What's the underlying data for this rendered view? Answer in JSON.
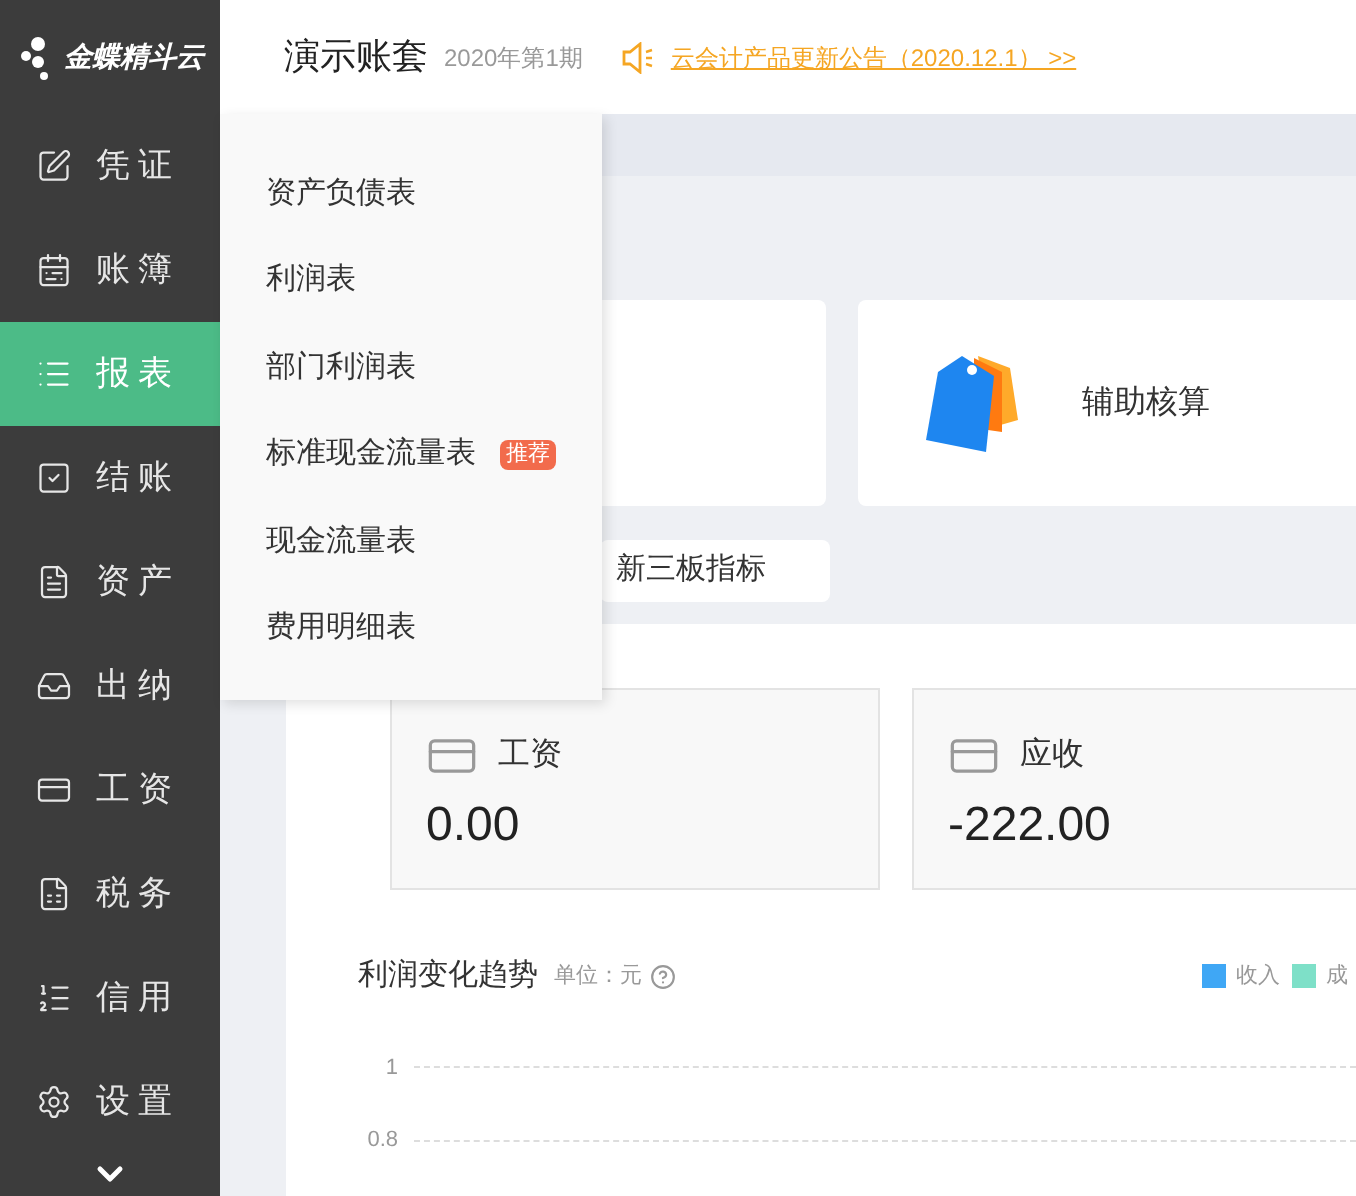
{
  "logo": {
    "text": "金蝶精斗云"
  },
  "sidebar": {
    "items": [
      {
        "label": "凭证",
        "selected": false
      },
      {
        "label": "账簿",
        "selected": false
      },
      {
        "label": "报表",
        "selected": true
      },
      {
        "label": "结账",
        "selected": false
      },
      {
        "label": "资产",
        "selected": false
      },
      {
        "label": "出纳",
        "selected": false
      },
      {
        "label": "工资",
        "selected": false
      },
      {
        "label": "税务",
        "selected": false
      },
      {
        "label": "信用",
        "selected": false
      },
      {
        "label": "设置",
        "selected": false
      }
    ]
  },
  "header": {
    "title": "演示账套",
    "period": "2020年第1期",
    "notice": "云会计产品更新公告（2020.12.1） >>"
  },
  "report_menu": {
    "items": [
      {
        "label": "资产负债表"
      },
      {
        "label": "利润表"
      },
      {
        "label": "部门利润表"
      },
      {
        "label": "标准现金流量表",
        "badge": "推荐"
      },
      {
        "label": "现金流量表"
      },
      {
        "label": "费用明细表"
      }
    ]
  },
  "shortcut_cards": [
    {
      "label": "辅助核算"
    }
  ],
  "report_buttons": [
    "新三板指标"
  ],
  "stat_cards": [
    {
      "label": "工资",
      "value": "0.00"
    },
    {
      "label": "应收",
      "value": "-222.00"
    }
  ],
  "profit_chart": {
    "title": "利润变化趋势",
    "unit": "单位：元",
    "legend": [
      {
        "name": "收入",
        "color": "#3fa7f5"
      },
      {
        "name": "成",
        "color": "#7ee0c8"
      }
    ],
    "y_ticks": [
      "1",
      "0.8"
    ]
  }
}
